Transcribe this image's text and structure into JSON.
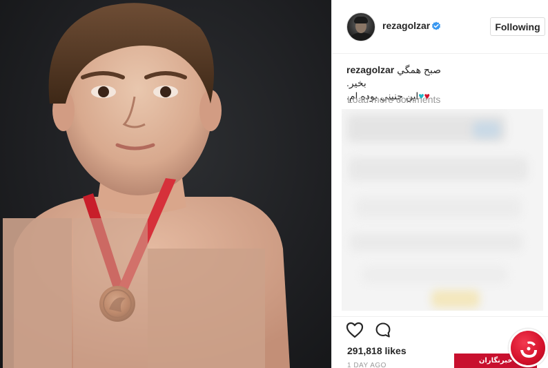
{
  "post": {
    "username": "rezagolzar",
    "follow_label": "Following",
    "caption_user": "rezagolzar",
    "caption_line1": "صبح همگي بخير.",
    "caption_line2": "اين چنيني بوده ام.",
    "hearts": [
      "♥",
      "♥"
    ],
    "load_more": "Load more comments",
    "likes": "291,818 likes",
    "time": "1 DAY AGO"
  },
  "watermark": {
    "text": "باشگاه خبرنگاران"
  },
  "icons": {
    "verified": "verified-badge-icon",
    "like": "heart-outline-icon",
    "comment": "comment-bubble-icon"
  },
  "colors": {
    "verified_blue": "#3897f0",
    "heart_red": "#d0142c",
    "heart_teal": "#1fb6c7",
    "watermark_red": "#c8102e",
    "muted_text": "#999999"
  }
}
